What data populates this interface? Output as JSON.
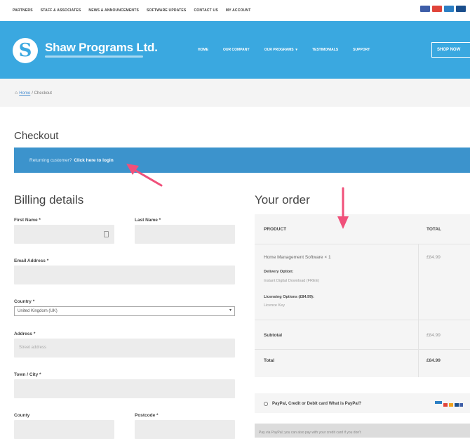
{
  "topnav": [
    "PARTNERS",
    "STAFF & ASSOCIATES",
    "NEWS & ANNOUNCEMENTS",
    "SOFTWARE UPDATES",
    "CONTACT US",
    "MY ACCOUNT"
  ],
  "payment_cards": [
    {
      "name": "card-icon-1",
      "color": "#3e5ea8"
    },
    {
      "name": "card-icon-2",
      "color": "#e0443a"
    },
    {
      "name": "card-icon-3",
      "color": "#2c7fc4"
    },
    {
      "name": "card-icon-4",
      "color": "#1a4e8c"
    }
  ],
  "brand": {
    "name": "Shaw Programs Ltd.",
    "accent": "#3aa8e0"
  },
  "mainnav": [
    "HOME",
    "OUR COMPANY",
    "OUR PROGRAMS",
    "TESTIMONIALS",
    "SUPPORT"
  ],
  "shop_now": "SHOP NOW",
  "breadcrumb": {
    "home": "Home",
    "current": "/ Checkout"
  },
  "page_title": "Checkout",
  "returning": {
    "text": "Returning customer?",
    "link": "Click here to login"
  },
  "billing": {
    "title": "Billing details",
    "first_name": "First Name *",
    "last_name": "Last Name *",
    "email": "Email Address *",
    "country": "Country *",
    "country_value": "United Kingdom (UK)",
    "address": "Address *",
    "address_placeholder": "Street address",
    "town": "Town / City *",
    "county": "County",
    "postcode": "Postcode *"
  },
  "order": {
    "title": "Your order",
    "col_product": "PRODUCT",
    "col_total": "TOTAL",
    "item": "Home Management Software × 1",
    "item_total": "£84.99",
    "delivery_label": "Delivery Option:",
    "delivery_value": "Instant Digital Download (FREE)",
    "licensing_label": "Licensing Options (£84.99):",
    "licensing_value": "Licence Key",
    "subtotal_label": "Subtotal",
    "subtotal_value": "£84.99",
    "total_label": "Total",
    "total_value": "£84.99"
  },
  "payment": {
    "option": "PayPal, Credit or Debit card What is PayPal?",
    "note": "Pay via PayPal; you can also pay with your credit card if you don't"
  },
  "annotation_color": "#f0507a"
}
